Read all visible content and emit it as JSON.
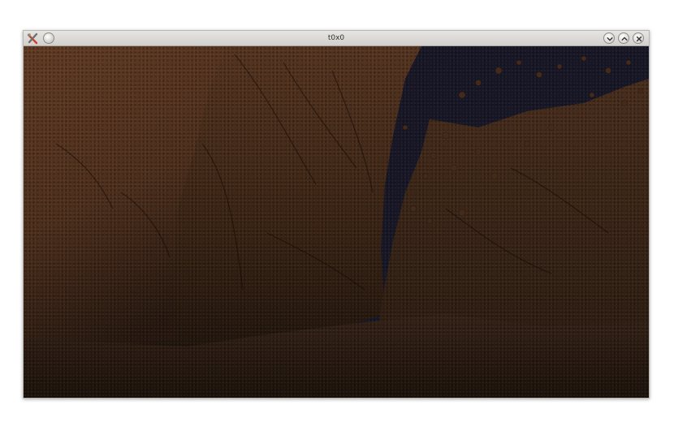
{
  "window": {
    "title": "t0x0"
  },
  "icons": {
    "app": "x-tools-icon",
    "menu": "window-menu-icon",
    "minimize": "chevron-down-icon",
    "maximize": "chevron-up-icon",
    "close": "close-icon"
  },
  "colors": {
    "titlebar": "#d6d4d0",
    "sky": "#1b1a2c",
    "rock_light": "#6e4429",
    "rock_dark": "#2c1c12"
  }
}
